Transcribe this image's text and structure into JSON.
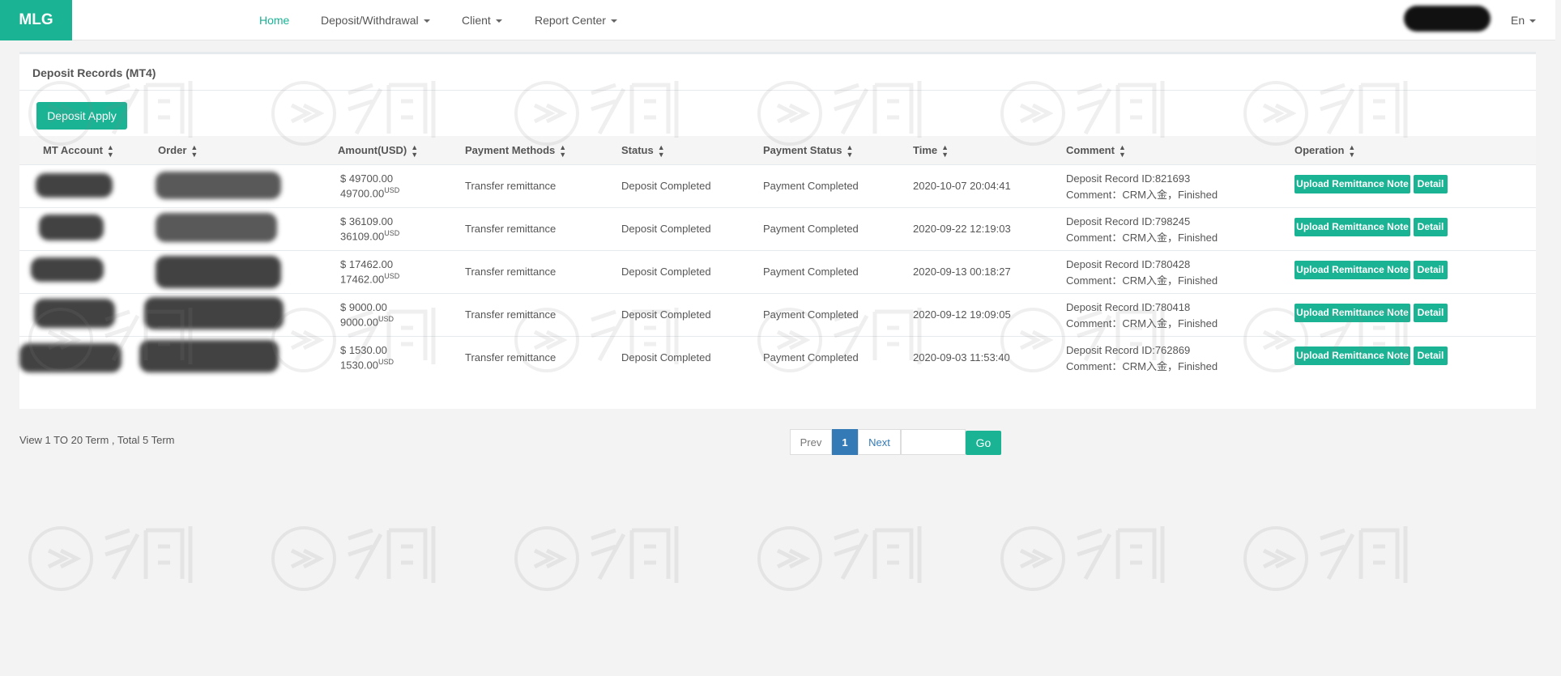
{
  "nav": {
    "brand": "MLG",
    "items": [
      {
        "label": "Home"
      },
      {
        "label": "Deposit/Withdrawal"
      },
      {
        "label": "Client"
      },
      {
        "label": "Report Center"
      }
    ],
    "lang": "En"
  },
  "panel": {
    "title": "Deposit Records  (MT4)",
    "apply_button": "Deposit Apply"
  },
  "table": {
    "headers": [
      "MT Account",
      "Order",
      "Amount(USD)",
      "Payment Methods",
      "Status",
      "Payment Status",
      "Time",
      "Comment",
      "Operation"
    ],
    "rows": [
      {
        "amount": "$ 49700.00",
        "amount_usd": "49700.00",
        "usd_sup": "USD",
        "method": "Transfer remittance",
        "status": "Deposit Completed",
        "payment_status": "Payment Completed",
        "time": "2020-10-07 20:04:41",
        "record": "Deposit Record ID:821693",
        "comment": "Comment：CRM入金，Finished"
      },
      {
        "amount": "$ 36109.00",
        "amount_usd": "36109.00",
        "usd_sup": "USD",
        "method": "Transfer remittance",
        "status": "Deposit Completed",
        "payment_status": "Payment Completed",
        "time": "2020-09-22 12:19:03",
        "record": "Deposit Record ID:798245",
        "comment": "Comment：CRM入金，Finished"
      },
      {
        "amount": "$ 17462.00",
        "amount_usd": "17462.00",
        "usd_sup": "USD",
        "method": "Transfer remittance",
        "status": "Deposit Completed",
        "payment_status": "Payment Completed",
        "time": "2020-09-13 00:18:27",
        "record": "Deposit Record ID:780428",
        "comment": "Comment：CRM入金，Finished"
      },
      {
        "amount": "$ 9000.00",
        "amount_usd": "9000.00",
        "usd_sup": "USD",
        "method": "Transfer remittance",
        "status": "Deposit Completed",
        "payment_status": "Payment Completed",
        "time": "2020-09-12 19:09:05",
        "record": "Deposit Record ID:780418",
        "comment": "Comment：CRM入金，Finished"
      },
      {
        "amount": "$ 1530.00",
        "amount_usd": "1530.00",
        "usd_sup": "USD",
        "method": "Transfer remittance",
        "status": "Deposit Completed",
        "payment_status": "Payment Completed",
        "time": "2020-09-03 11:53:40",
        "record": "Deposit Record ID:762869",
        "comment": "Comment：CRM入金，Finished"
      }
    ],
    "op_upload": "Upload Remittance Note",
    "op_detail": "Detail"
  },
  "footer": {
    "view_info": "View  1  TO  20  Term , Total 5 Term",
    "prev": "Prev",
    "current_page": "1",
    "next": "Next",
    "go": "Go",
    "page_input": ""
  },
  "colors": {
    "accent": "#1ab394",
    "pager_active": "#337ab7"
  }
}
